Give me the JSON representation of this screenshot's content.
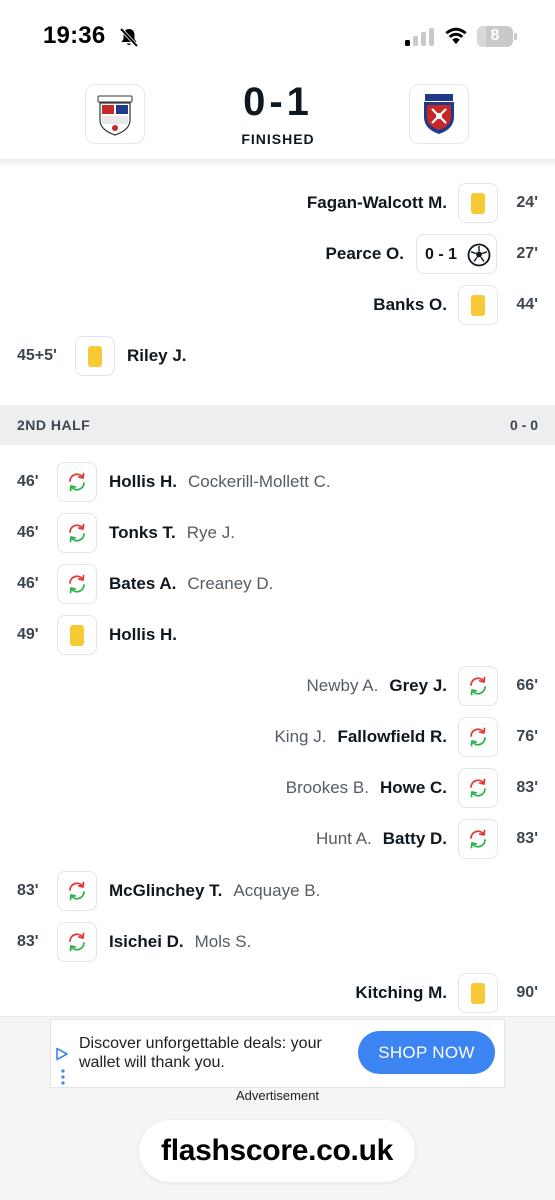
{
  "status_bar": {
    "time": "19:36",
    "battery": "8"
  },
  "match": {
    "score": "0-1",
    "status": "FINISHED",
    "home_logo": "badge-icon",
    "away_logo": "badge-icon"
  },
  "incidents_first_half": [
    {
      "side": "away",
      "minute": "24'",
      "type": "yellow-card",
      "player": "Fagan-Walcott M."
    },
    {
      "side": "away",
      "minute": "27'",
      "type": "goal",
      "player": "Pearce O.",
      "score": "0 - 1"
    },
    {
      "side": "away",
      "minute": "44'",
      "type": "yellow-card",
      "player": "Banks O."
    },
    {
      "side": "home",
      "minute": "45+5'",
      "type": "yellow-card",
      "player": "Riley J."
    }
  ],
  "second_half": {
    "label": "2ND HALF",
    "score": "0 - 0",
    "incidents": [
      {
        "side": "home",
        "minute": "46'",
        "type": "substitution",
        "player": "Hollis H.",
        "secondary": "Cockerill-Mollett C."
      },
      {
        "side": "home",
        "minute": "46'",
        "type": "substitution",
        "player": "Tonks T.",
        "secondary": "Rye J."
      },
      {
        "side": "home",
        "minute": "46'",
        "type": "substitution",
        "player": "Bates A.",
        "secondary": "Creaney D."
      },
      {
        "side": "home",
        "minute": "49'",
        "type": "yellow-card",
        "player": "Hollis H."
      },
      {
        "side": "away",
        "minute": "66'",
        "type": "substitution",
        "player": "Grey J.",
        "secondary": "Newby A."
      },
      {
        "side": "away",
        "minute": "76'",
        "type": "substitution",
        "player": "Fallowfield R.",
        "secondary": "King J."
      },
      {
        "side": "away",
        "minute": "83'",
        "type": "substitution",
        "player": "Howe C.",
        "secondary": "Brookes B."
      },
      {
        "side": "away",
        "minute": "83'",
        "type": "substitution",
        "player": "Batty D.",
        "secondary": "Hunt A."
      },
      {
        "side": "home",
        "minute": "83'",
        "type": "substitution",
        "player": "McGlinchey T.",
        "secondary": "Acquaye B."
      },
      {
        "side": "home",
        "minute": "83'",
        "type": "substitution",
        "player": "Isichei D.",
        "secondary": "Mols S."
      },
      {
        "side": "away",
        "minute": "90'",
        "type": "yellow-card",
        "player": "Kitching M."
      }
    ]
  },
  "ad": {
    "text": "Discover unforgettable deals: your wallet will thank you.",
    "button": "SHOP NOW",
    "caption": "Advertisement"
  },
  "browser": {
    "url": "flashscore.co.uk"
  },
  "colors": {
    "yellow_card": "#f6c935",
    "sub_in": "#2ab34a",
    "sub_out": "#e03a3a",
    "ad_button": "#3b84f2",
    "period_bg": "#eceeef"
  }
}
